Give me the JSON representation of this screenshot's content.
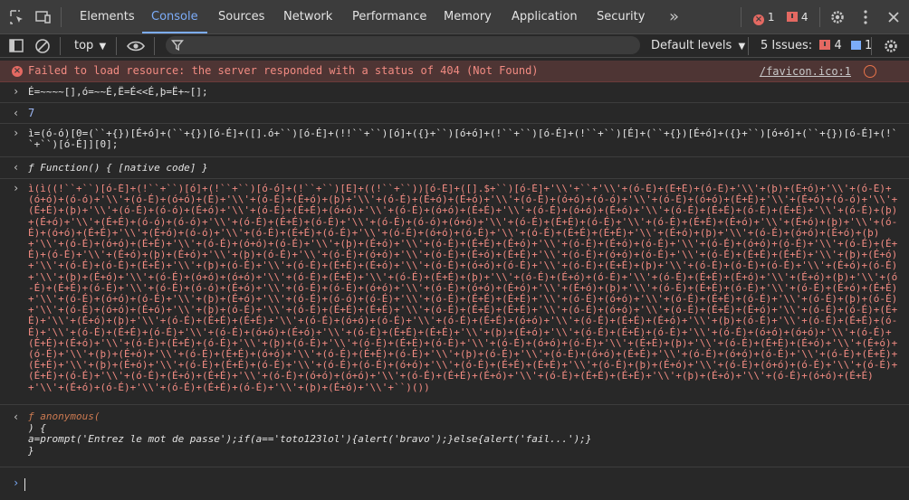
{
  "tabs": [
    {
      "label": "Elements",
      "active": false
    },
    {
      "label": "Console",
      "active": true
    },
    {
      "label": "Sources",
      "active": false
    },
    {
      "label": "Network",
      "active": false
    },
    {
      "label": "Performance",
      "active": false
    },
    {
      "label": "Memory",
      "active": false
    },
    {
      "label": "Application",
      "active": false
    },
    {
      "label": "Security",
      "active": false
    }
  ],
  "topbar": {
    "more_tabs": "»",
    "error_count": "1",
    "warning_count": "4"
  },
  "toolbar": {
    "context": "top",
    "filter_placeholder": "",
    "levels": "Default levels",
    "issues_label": "5 Issues:",
    "issues_errors": "4",
    "issues_info": "1"
  },
  "colors": {
    "accent": "#7cacf8",
    "error": "#e46962",
    "error_bg": "#4e3534",
    "panel_bg": "#282828"
  },
  "console": {
    "error_message": "Failed to load resource: the server responded with a status of 404 (Not Found)",
    "error_source": "/favicon.ico:1",
    "input1": "É=~~~~[],ó=~~É,Ë=É<<É,þ=Ë+~[];",
    "output1": "7",
    "input2": "ì=(ó-ó)[0=(``+{})[É+ó]+(``+{})[ó-É]+([].ó+``)[ó-É]+(!!``+``)[ó]+({}+``)[ó+ó]+(!``+``)[ó-É]+(!``+``)[É]+(``+{})[É+ó]+({}+``)[ó+ó]+(``+{})[ó-É]+(!``+``)[ó-É]][0];",
    "output2": "ƒ Function() { [native code] }",
    "input3": "ì(ì((!``+``)[ó-É]+(!``+``)[ó]+(!``+``)[ó-ó]+(!``+``)[É]+((!``+``))[ó-É]+([].$+``)[ó-É]+'\\\\'+``+'\\\\'+(ó-É)+(É+É)+(ó-É)+'\\\\'+(þ)+(É+ó)+'\\\\'+(ó-É)+(ó+ó)+(ó-ó)+'\\\\'+(ó-É)+(ó+ó)+(É)+'\\\\'+(ó-É)+(É+ó)+(þ)+'\\\\'+(ó-É)+(É+ó)+(É+ó)+'\\\\'+(ó-É)+(ó+ó)+(ó-ó)+'\\\\'+(ó-É)+(ó+ó)+(É+É)+'\\\\'+(É+ó)+(ó-ó)+'\\\\'+(É+É)+(þ)+'\\\\'+(ó-É)+(ó-ó)+(É+ó)+'\\\\'+(ó-É)+(É+É)+(ó+ó)+'\\\\'+(ó-É)+(ó+ó)+(É+É)+'\\\\'+(ó-É)+(ó+ó)+(É+ó)+'\\\\'+(ó-É)+(É+É)+(ó-É)+(É+É)+'\\\\'+(ó-É)+(þ)+(É+ó)+'\\\\'+(É+É)+(ó-ó)+(ó-ó)+'\\\\'+(ó-É)+(É+É)+(ó-É)+'\\\\'+(ó-É)+(ó-ó)+(ó+ó)+'\\\\'+(ó-É)+(É+É)+(ó-É)+'\\\\'+(ó-É)+(É+É)+(É+ó)+'\\\\'+(É+ó)+(þ)+'\\\\'+(ó-É)+(ó+ó)+(É+É)+'\\\\'+(É+ó)+(ó-ó)+'\\\\'+(ó-É)+(É+É)+(ó-É)+'\\\\'+(ó-É)+(ó+ó)+(ó-É)+'\\\\'+(ó-É)+(É+É)+(É+É)+'\\\\'+(É+ó)+(þ)+'\\\\'+(ó-É)+(ó+ó)+(É+ó)+(þ)+'\\\\'+(ó-É)+(ó+ó)+(É+É)+'\\\\'+(ó-É)+(ó+ó)+(ó-É)+'\\\\'+(þ)+(É+ó)+'\\\\'+(ó-É)+(É+É)+(É+ó)+'\\\\'+(ó-É)+(É+ó)+(ó-É)+'\\\\'+(ó-É)+(ó+ó)+(ó-É)+'\\\\'+(ó-É)+(É+É)+(ó-É)+'\\\\'+(É+ó)+(þ)+(É+ó)+'\\\\'+(þ)+(ó-É)+'\\\\'+(ó-É)+(ó+ó)+'\\\\'+(ó-É)+(É+ó)+(É+É)+'\\\\'+(ó-É)+(ó+ó)+(ó-É)+'\\\\'+(ó-É)+(É+É)+(É+É)+'\\\\'+(þ)+(É+ó)+'\\\\'+(ó-É)+(ó-É)+(É+É)+'\\\\'+(þ)+(ó-É)+'\\\\'+(ó-É)+(É+É)+(É+ó)+'\\\\'+(ó-É)+(ó+ó)+(ó-É)+'\\\\'+(ó-É)+(É+É)+(þ)+'\\\\'+(ó-É)+(ó-É)+(ó-É)+'\\\\'+(É+ó)+(ó-É)+'\\\\'+(þ)+(É+ó)+'\\\\'+(ó-É)+(ó+ó)+(ó+ó)+'\\\\'+(ó-É)+(É+É)+'\\\\'+(ó-É)+(É+É)+(þ)+'\\\\'+(ó-É)+(É+ó)+(ó-É)+'\\\\'+(ó-É)+(É+É)+(É+ó)+'\\\\'+(É+ó)+(þ)+'\\\\'+(ó-É)+(É+É)+(ó-É)+'\\\\'+(ó-É)+(ó-ó)+(É+ó)+'\\\\'+(ó-É)+(ó-É)+(ó+ó)+'\\\\'+(ó-É)+(ó+ó)+(É+ó)+'\\\\'+(É+ó)+(þ)+'\\\\'+(ó-É)+(É+É)+(ó-É)+'\\\\'+(ó-É)+(É+ó)+(É+É)+'\\\\'+(ó-É)+(ó+ó)+(ó-É)+'\\\\'+(þ)+(É+ó)+'\\\\'+(ó-É)+(ó-ó)+(ó-É)+'\\\\'+(ó-É)+(É+É)+(É+É)+'\\\\'+(ó-É)+(ó+ó)+'\\\\'+(ó-É)+(É+É)+(ó-É)+'\\\\'+(ó-É)+(þ)+(ó-É)+'\\\\'+(ó-É)+(ó+ó)+(É+ó)+'\\\\'+(þ)+(ó-É)+'\\\\'+(ó-É)+(É+É)+(É+É)+'\\\\'+(ó-É)+(É+É)+(É+É)+'\\\\'+(ó-É)+(ó+ó)+'\\\\'+(ó-É)+(É+É)+(É+ó)+'\\\\'+(ó-É)+(ó-É)+(É+É)+'\\\\'+(É+ó)+(þ)+'\\\\'+(ó-É)+(É+É)+(É+É)+'\\\\'+(ó-É)+(ó+ó)+(ó-É)+'\\\\'+(ó-É)+(É+É)+(ó+ó)+'\\\\'+(ó-É)+(É+É)+(É+ó)+'\\\\'+(þ)+(ó-É)+'\\\\'+(ó-É)+(É+É)+(ó-É)+'\\\\'+(ó-É)+(É+É)+(ó-É)+'\\\\'+(ó-É)+(ó+ó)+(É+ó)+'\\\\'+(ó-É)+(É+É)+(É+É)+'\\\\'+(þ)+(É+ó)+'\\\\'+(ó-É)+(É+É)+(ó-É)+'\\\\'+(ó-É)+(ó+ó)+(ó+ó)+'\\\\'+(ó-É)+(É+É)+(É+ó)+'\\\\'+(ó-É)+(É+É)+(ó-É)+'\\\\'+(þ)+(ó-É)+'\\\\'+(ó-É)+(É+É)+(ó-É)+'\\\\'+(ó-É)+(ó+ó)+(ó-É)+'\\\\'+(É+É)+(þ)+'\\\\'+(ó-É)+(É+É)+(É+ó)+'\\\\'+(É+ó)+(ó-É)+'\\\\'+(þ)+(É+ó)+'\\\\'+(ó-É)+(É+É)+(ó+ó)+'\\\\'+(ó-É)+(É+É)+(ó-É)+'\\\\'+(þ)+(ó-É)+'\\\\'+(ó-É)+(ó+ó)+(É+É)+'\\\\'+(ó-É)+(ó+ó)+(ó-É)+'\\\\'+(ó-É)+(É+É)+(É+É)+'\\\\'+(þ)+(É+ó)+'\\\\'+(ó-É)+(É+É)+(ó-É)+'\\\\'+(ó-É)+(ó-É)+(ó+ó)+'\\\\'+(ó-É)+(É+É)+(É+É)+'\\\\'+(ó-É)+(þ)+(É+ó)+'\\\\'+(ó-É)+(ó+ó)+(ó-É)+'\\\\'+(ó-É)+(É+É)+(ó-É)+'\\\\'+(ó-É)+(É+ó)+(É+É)+'\\\\'+(ó-É)+(ó+ó)+(ó+ó)+'\\\\'+(ó-É)+(É+É)+(É+ó)+'\\\\'+(ó-É)+(É+É)+(É+É)+'\\\\'+(þ)+(É+ó)+'\\\\'+(ó-É)+(ó+ó)+(É+É)+'\\\\'+(É+ó)+(ó-É)+'\\\\'+(ó-É)+(É+É)+(ó-É)+'\\\\'+(þ)+(É+ó)+'\\\\'+``)())",
    "output3_sig": "ƒ anonymous(",
    "output3_body": ") {\na=prompt('Entrez le mot de passe');if(a=='toto123lol'){alert('bravo');}else{alert('fail...');}\n}",
    "prompt_symbol": "›",
    "output_symbol": "‹"
  }
}
